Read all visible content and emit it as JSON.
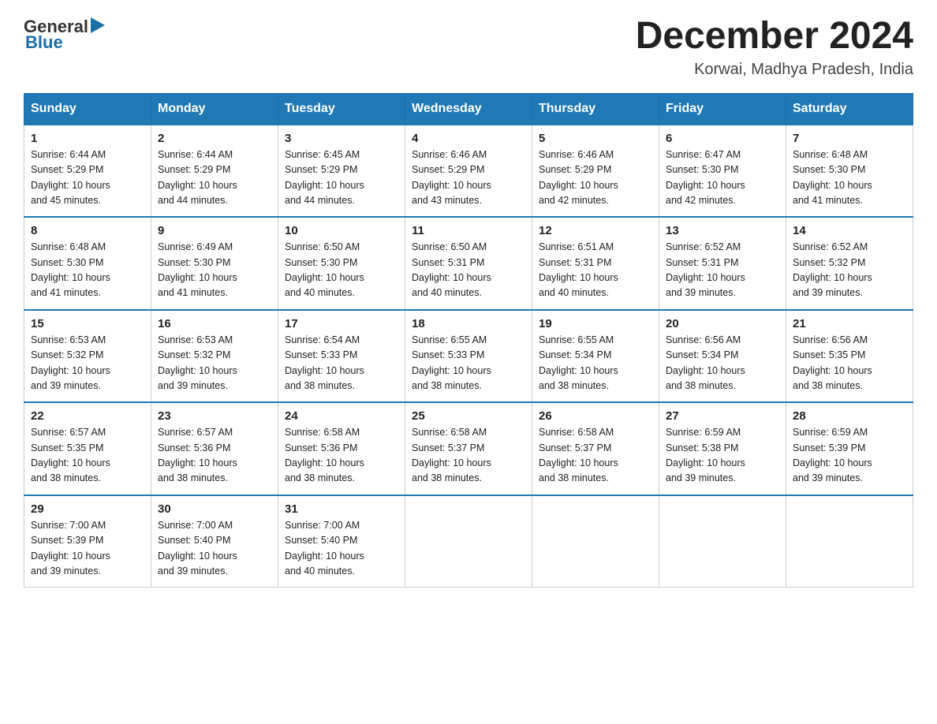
{
  "logo": {
    "general": "General",
    "blue": "Blue",
    "arrow_color": "#1a6fa8"
  },
  "header": {
    "title": "December 2024",
    "location": "Korwai, Madhya Pradesh, India"
  },
  "days_of_week": [
    "Sunday",
    "Monday",
    "Tuesday",
    "Wednesday",
    "Thursday",
    "Friday",
    "Saturday"
  ],
  "weeks": [
    [
      {
        "day": "1",
        "sunrise": "6:44 AM",
        "sunset": "5:29 PM",
        "daylight": "10 hours and 45 minutes."
      },
      {
        "day": "2",
        "sunrise": "6:44 AM",
        "sunset": "5:29 PM",
        "daylight": "10 hours and 44 minutes."
      },
      {
        "day": "3",
        "sunrise": "6:45 AM",
        "sunset": "5:29 PM",
        "daylight": "10 hours and 44 minutes."
      },
      {
        "day": "4",
        "sunrise": "6:46 AM",
        "sunset": "5:29 PM",
        "daylight": "10 hours and 43 minutes."
      },
      {
        "day": "5",
        "sunrise": "6:46 AM",
        "sunset": "5:29 PM",
        "daylight": "10 hours and 42 minutes."
      },
      {
        "day": "6",
        "sunrise": "6:47 AM",
        "sunset": "5:30 PM",
        "daylight": "10 hours and 42 minutes."
      },
      {
        "day": "7",
        "sunrise": "6:48 AM",
        "sunset": "5:30 PM",
        "daylight": "10 hours and 41 minutes."
      }
    ],
    [
      {
        "day": "8",
        "sunrise": "6:48 AM",
        "sunset": "5:30 PM",
        "daylight": "10 hours and 41 minutes."
      },
      {
        "day": "9",
        "sunrise": "6:49 AM",
        "sunset": "5:30 PM",
        "daylight": "10 hours and 41 minutes."
      },
      {
        "day": "10",
        "sunrise": "6:50 AM",
        "sunset": "5:30 PM",
        "daylight": "10 hours and 40 minutes."
      },
      {
        "day": "11",
        "sunrise": "6:50 AM",
        "sunset": "5:31 PM",
        "daylight": "10 hours and 40 minutes."
      },
      {
        "day": "12",
        "sunrise": "6:51 AM",
        "sunset": "5:31 PM",
        "daylight": "10 hours and 40 minutes."
      },
      {
        "day": "13",
        "sunrise": "6:52 AM",
        "sunset": "5:31 PM",
        "daylight": "10 hours and 39 minutes."
      },
      {
        "day": "14",
        "sunrise": "6:52 AM",
        "sunset": "5:32 PM",
        "daylight": "10 hours and 39 minutes."
      }
    ],
    [
      {
        "day": "15",
        "sunrise": "6:53 AM",
        "sunset": "5:32 PM",
        "daylight": "10 hours and 39 minutes."
      },
      {
        "day": "16",
        "sunrise": "6:53 AM",
        "sunset": "5:32 PM",
        "daylight": "10 hours and 39 minutes."
      },
      {
        "day": "17",
        "sunrise": "6:54 AM",
        "sunset": "5:33 PM",
        "daylight": "10 hours and 38 minutes."
      },
      {
        "day": "18",
        "sunrise": "6:55 AM",
        "sunset": "5:33 PM",
        "daylight": "10 hours and 38 minutes."
      },
      {
        "day": "19",
        "sunrise": "6:55 AM",
        "sunset": "5:34 PM",
        "daylight": "10 hours and 38 minutes."
      },
      {
        "day": "20",
        "sunrise": "6:56 AM",
        "sunset": "5:34 PM",
        "daylight": "10 hours and 38 minutes."
      },
      {
        "day": "21",
        "sunrise": "6:56 AM",
        "sunset": "5:35 PM",
        "daylight": "10 hours and 38 minutes."
      }
    ],
    [
      {
        "day": "22",
        "sunrise": "6:57 AM",
        "sunset": "5:35 PM",
        "daylight": "10 hours and 38 minutes."
      },
      {
        "day": "23",
        "sunrise": "6:57 AM",
        "sunset": "5:36 PM",
        "daylight": "10 hours and 38 minutes."
      },
      {
        "day": "24",
        "sunrise": "6:58 AM",
        "sunset": "5:36 PM",
        "daylight": "10 hours and 38 minutes."
      },
      {
        "day": "25",
        "sunrise": "6:58 AM",
        "sunset": "5:37 PM",
        "daylight": "10 hours and 38 minutes."
      },
      {
        "day": "26",
        "sunrise": "6:58 AM",
        "sunset": "5:37 PM",
        "daylight": "10 hours and 38 minutes."
      },
      {
        "day": "27",
        "sunrise": "6:59 AM",
        "sunset": "5:38 PM",
        "daylight": "10 hours and 39 minutes."
      },
      {
        "day": "28",
        "sunrise": "6:59 AM",
        "sunset": "5:39 PM",
        "daylight": "10 hours and 39 minutes."
      }
    ],
    [
      {
        "day": "29",
        "sunrise": "7:00 AM",
        "sunset": "5:39 PM",
        "daylight": "10 hours and 39 minutes."
      },
      {
        "day": "30",
        "sunrise": "7:00 AM",
        "sunset": "5:40 PM",
        "daylight": "10 hours and 39 minutes."
      },
      {
        "day": "31",
        "sunrise": "7:00 AM",
        "sunset": "5:40 PM",
        "daylight": "10 hours and 40 minutes."
      },
      null,
      null,
      null,
      null
    ]
  ],
  "labels": {
    "sunrise": "Sunrise:",
    "sunset": "Sunset:",
    "daylight": "Daylight:"
  }
}
